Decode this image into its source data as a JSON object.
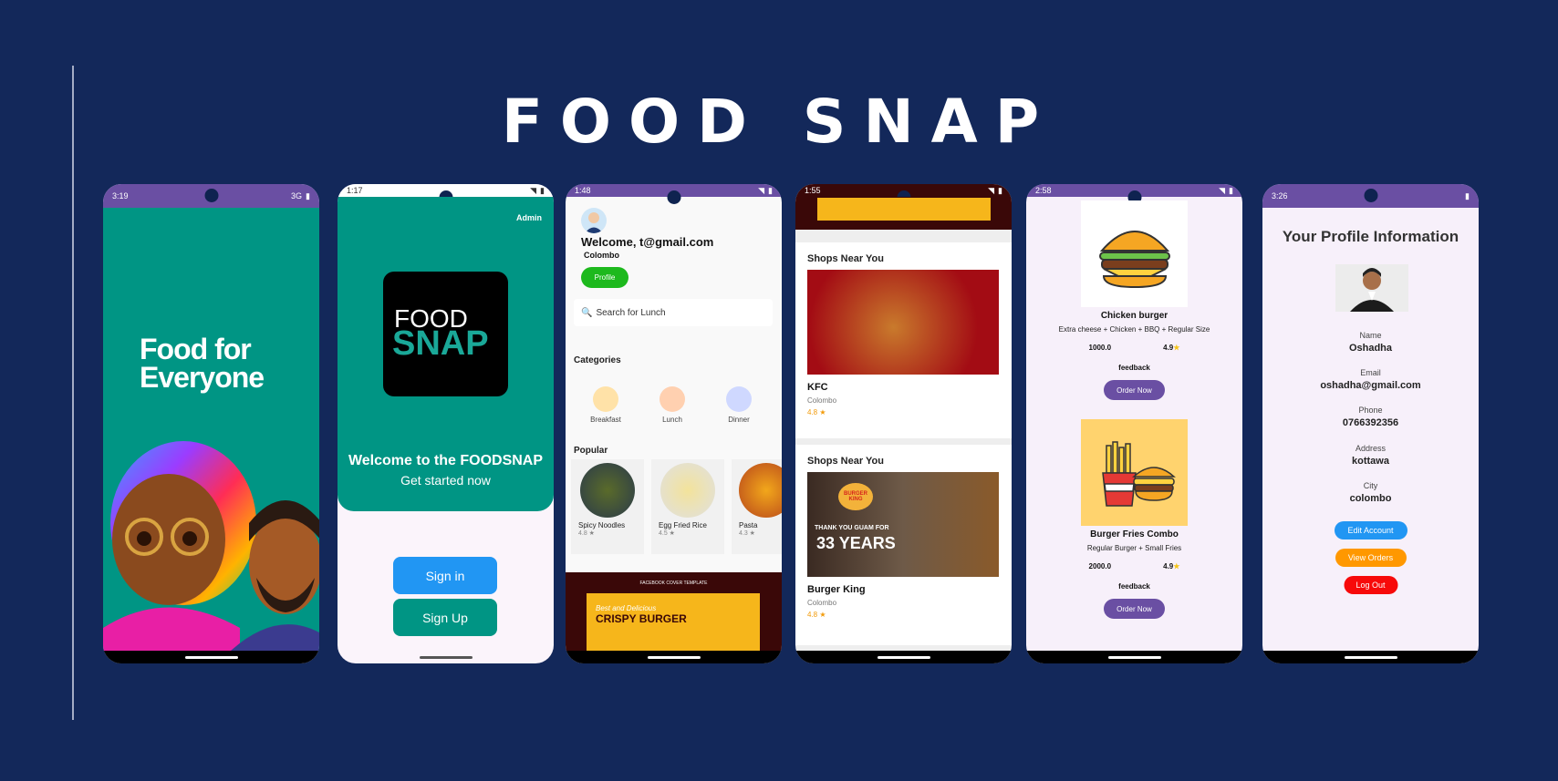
{
  "app_title": "FOOD SNAP",
  "phone1": {
    "time": "3:19",
    "network": "3G",
    "tagline_line1": "Food for",
    "tagline_line2": "Everyone"
  },
  "phone2": {
    "time": "1:17",
    "admin": "Admin",
    "logo_top": "FOOD",
    "logo_bottom": "SNAP",
    "welcome": "Welcome to the FOODSNAP",
    "subtitle": "Get started now",
    "sign_in": "Sign in",
    "sign_up": "Sign Up"
  },
  "phone3": {
    "time": "1:48",
    "welcome": "Welcome, t@gmail.com",
    "city": "Colombo",
    "profile_btn": "Profile",
    "search_placeholder": "Search for Lunch",
    "categories_title": "Categories",
    "categories": [
      {
        "label": "Breakfast"
      },
      {
        "label": "Lunch"
      },
      {
        "label": "Dinner"
      }
    ],
    "popular_title": "Popular",
    "popular": [
      {
        "name": "Spicy Noodles",
        "rating": "4.8 ★"
      },
      {
        "name": "Egg Fried Rice",
        "rating": "4.5 ★"
      },
      {
        "name": "Pasta",
        "rating": "4.3 ★"
      }
    ],
    "banner_caption": "FACEBOOK COVER TEMPLATE",
    "banner_line1": "Best and Delicious",
    "banner_line2": "CRISPY BURGER"
  },
  "phone4": {
    "time": "1:55",
    "shops": [
      {
        "section": "Shops Near You",
        "name": "KFC",
        "location": "Colombo",
        "rating": "4.8 ★"
      },
      {
        "section": "Shops Near You",
        "name": "Burger King",
        "location": "Colombo",
        "rating": "4.8 ★",
        "image_text1": "BURGER KING",
        "image_text2": "THANK YOU GUAM FOR",
        "image_text3": "33 YEARS"
      }
    ]
  },
  "phone5": {
    "time": "2:58",
    "items": [
      {
        "name": "Chicken burger",
        "desc": "Extra cheese + Chicken + BBQ + Regular Size",
        "price": "1000.0",
        "rating": "4.9",
        "feedback": "feedback",
        "order": "Order Now"
      },
      {
        "name": "Burger Fries Combo",
        "desc": "Regular Burger + Small Fries",
        "price": "2000.0",
        "rating": "4.9",
        "feedback": "feedback",
        "order": "Order Now"
      }
    ]
  },
  "phone6": {
    "time": "3:26",
    "title": "Your Profile Information",
    "fields": [
      {
        "label": "Name",
        "value": "Oshadha"
      },
      {
        "label": "Email",
        "value": "oshadha@gmail.com"
      },
      {
        "label": "Phone",
        "value": "0766392356"
      },
      {
        "label": "Address",
        "value": "kottawa"
      },
      {
        "label": "City",
        "value": "colombo"
      }
    ],
    "edit": "Edit Account",
    "orders": "View Orders",
    "logout": "Log Out"
  },
  "colors": {
    "background": "#13285a",
    "status_bar": "#6a4fa3",
    "teal": "#009584",
    "blue_button": "#2196f3",
    "orange_button": "#ff9800",
    "red_button": "#f70a0a",
    "green_button": "#1db91d"
  }
}
